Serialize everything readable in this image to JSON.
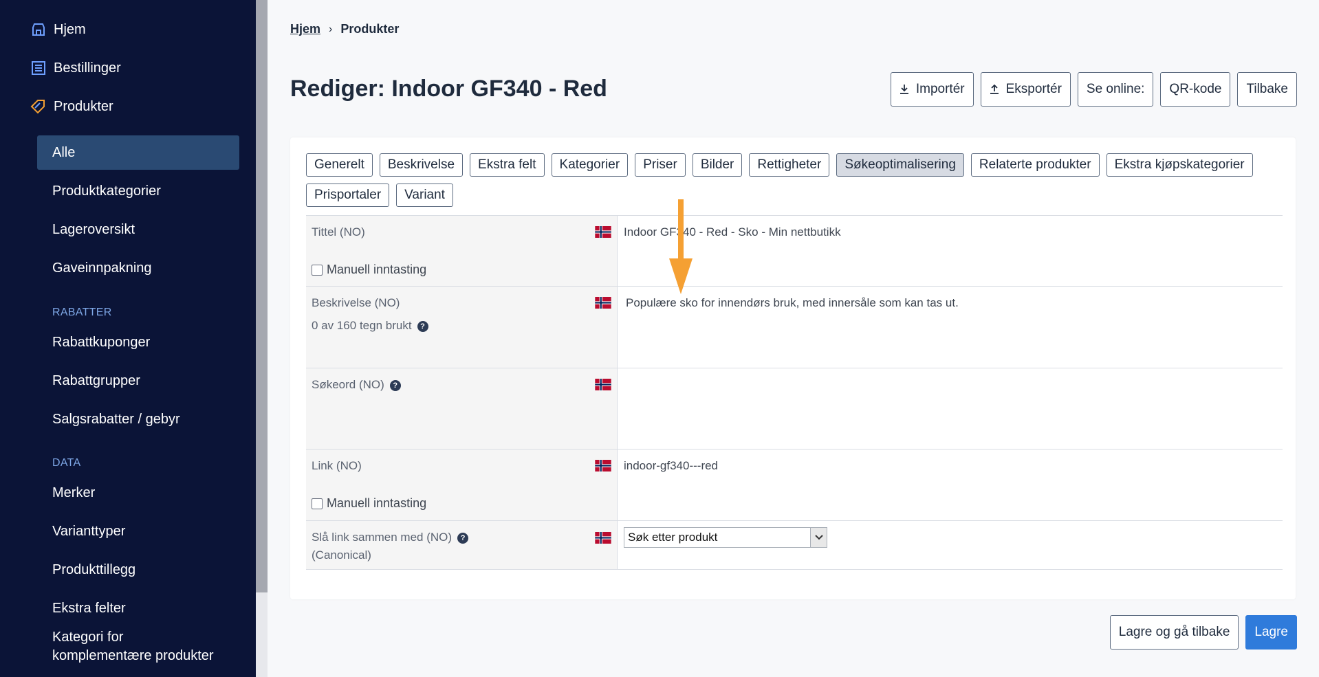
{
  "sidebar": {
    "items": [
      {
        "label": "Hjem",
        "icon": "store-icon"
      },
      {
        "label": "Bestillinger",
        "icon": "list-icon"
      },
      {
        "label": "Produkter",
        "icon": "tag-icon"
      }
    ],
    "sub_items": {
      "alle": "Alle",
      "produktkategorier": "Produktkategorier",
      "lageroversikt": "Lageroversikt",
      "gaveinnpakning": "Gaveinnpakning"
    },
    "section_rabatter": "RABATTER",
    "rabatter": {
      "rabattkuponger": "Rabattkuponger",
      "rabattgrupper": "Rabattgrupper",
      "salgsrabatter": "Salgsrabatter / gebyr"
    },
    "section_data": "DATA",
    "data": {
      "merker": "Merker",
      "varianttyper": "Varianttyper",
      "produkttillegg": "Produkttillegg",
      "ekstra_felter": "Ekstra felter",
      "kategori_line1": "Kategori for",
      "kategori_line2": "komplementære produkter"
    }
  },
  "breadcrumb": {
    "home": "Hjem",
    "current": "Produkter"
  },
  "page_title": "Rediger: Indoor GF340 - Red",
  "actions": {
    "import": "Importér",
    "export": "Eksportér",
    "online": "Se online:",
    "qr": "QR-kode",
    "back": "Tilbake"
  },
  "tabs": {
    "t1": "Generelt",
    "t2": "Beskrivelse",
    "t3": "Ekstra felt",
    "t4": "Kategorier",
    "t5": "Priser",
    "t6": "Bilder",
    "t7": "Rettigheter",
    "t8": "Søkeoptimalisering",
    "t9": "Relaterte produkter",
    "t10": "Ekstra kjøpskategorier",
    "t11": "Prisportaler",
    "t12": "Variant"
  },
  "form": {
    "title_label": "Tittel (NO)",
    "title_value": "Indoor GF340 - Red - Sko - Min nettbutikk",
    "manual_input": "Manuell inntasting",
    "desc_label": "Beskrivelse (NO)",
    "desc_count": "0 av 160 tegn brukt",
    "desc_value": "Populære sko for innendørs bruk, med innersåle som kan tas ut.",
    "keywords_label": "Søkeord (NO)",
    "keywords_value": "",
    "link_label": "Link (NO)",
    "link_value": "indoor-gf340---red",
    "merge_label": "Slå link sammen med (NO)",
    "merge_sub": "(Canonical)",
    "merge_select": "Søk etter produkt"
  },
  "bottom": {
    "save_back": "Lagre og gå tilbake",
    "save": "Lagre"
  },
  "colors": {
    "sidebar_bg": "#0b1437",
    "sidebar_active": "#2a4a73",
    "primary": "#2f7bdb",
    "annotation": "#f5a033"
  }
}
